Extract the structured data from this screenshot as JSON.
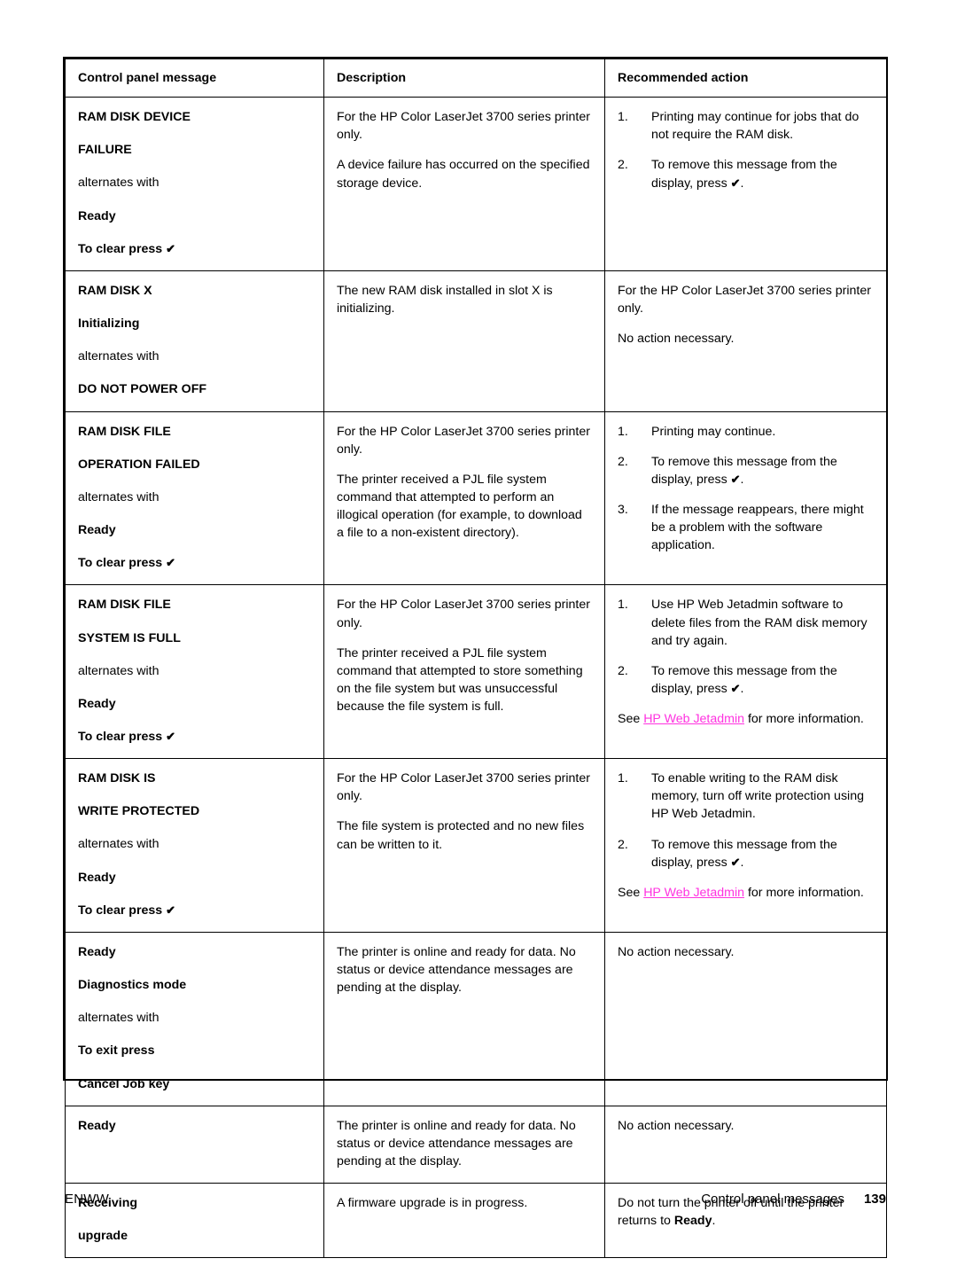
{
  "document": {
    "footer": {
      "left_label": "ENWW",
      "section_label": "Control panel messages",
      "page_number": "139"
    },
    "link_color": "#ff33e0",
    "check_glyph": "✔"
  },
  "table": {
    "headers": {
      "col1": "Control panel message",
      "col2": "Description",
      "col3": "Recommended action"
    },
    "rows": [
      {
        "message": {
          "l1": "RAM DISK DEVICE",
          "l2": "FAILURE",
          "l3": "alternates with",
          "l4": "Ready",
          "l5": "To clear press"
        },
        "description": {
          "p1": "For the HP Color LaserJet 3700 series printer only.",
          "p2": "A device failure has occurred on the specified storage device."
        },
        "action": {
          "steps": [
            "Printing may continue for jobs that do not require the RAM disk.",
            "To remove this message from the display, press"
          ]
        }
      },
      {
        "message": {
          "l1": "RAM DISK X",
          "l2": "Initializing",
          "l3": "alternates with",
          "l4": "DO NOT POWER OFF"
        },
        "description": {
          "p1": "The new RAM disk installed in slot X is initializing."
        },
        "action": {
          "p1": "For the HP Color LaserJet 3700 series printer only.",
          "p2": "No action necessary."
        }
      },
      {
        "message": {
          "l1": "RAM DISK FILE",
          "l2": "OPERATION FAILED",
          "l3": "alternates with",
          "l4": "Ready",
          "l5": "To clear press"
        },
        "description": {
          "p1": "For the HP Color LaserJet 3700 series printer only.",
          "p2": "The printer received a PJL file system command that attempted to perform an illogical operation (for example, to download a file to a non-existent directory)."
        },
        "action": {
          "steps": [
            "Printing may continue.",
            "To remove this message from the display, press",
            "If the message reappears, there might be a problem with the software application."
          ]
        }
      },
      {
        "message": {
          "l1": "RAM DISK FILE",
          "l2": "SYSTEM IS FULL",
          "l3": "alternates with",
          "l4": "Ready",
          "l5": "To clear press"
        },
        "description": {
          "p1": "For the HP Color LaserJet 3700 series printer only.",
          "p2": "The printer received a PJL file system command that attempted to store something on the file system but was unsuccessful because the file system is full."
        },
        "action": {
          "steps": [
            "Use HP Web Jetadmin software to delete files from the RAM disk memory and try again.",
            "To remove this message from the display, press"
          ],
          "see_prefix": "See ",
          "see_link": "HP Web Jetadmin",
          "see_suffix": " for more information."
        }
      },
      {
        "message": {
          "l1": "RAM DISK IS",
          "l2": "WRITE PROTECTED",
          "l3": "alternates with",
          "l4": "Ready",
          "l5": "To clear press"
        },
        "description": {
          "p1": "For the HP Color LaserJet 3700 series printer only.",
          "p2": "The file system is protected and no new files can be written to it."
        },
        "action": {
          "steps": [
            "To enable writing to the RAM disk memory, turn off write protection using HP Web Jetadmin.",
            "To remove this message from the display, press"
          ],
          "see_prefix": "See ",
          "see_link": "HP Web Jetadmin",
          "see_suffix": " for more information."
        }
      },
      {
        "message": {
          "l1": "Ready",
          "l2": "Diagnostics mode",
          "l3": "alternates with",
          "l4": "To exit press",
          "l5": "Cancel Job key"
        },
        "description": {
          "p1": "The printer is online and ready for data. No status or device attendance messages are pending at the display."
        },
        "action": {
          "p1": "No action necessary."
        }
      },
      {
        "message": {
          "l1": "Ready"
        },
        "description": {
          "p1": "The printer is online and ready for data. No status or device attendance messages are pending at the display."
        },
        "action": {
          "p1": "No action necessary."
        }
      },
      {
        "message": {
          "l1": "Receiving",
          "l2": "upgrade"
        },
        "description": {
          "p1": "A firmware upgrade is in progress."
        },
        "action": {
          "p1_prefix": "Do not turn the printer off until the printer returns to ",
          "p1_bold": "Ready",
          "p1_suffix": "."
        }
      }
    ]
  }
}
